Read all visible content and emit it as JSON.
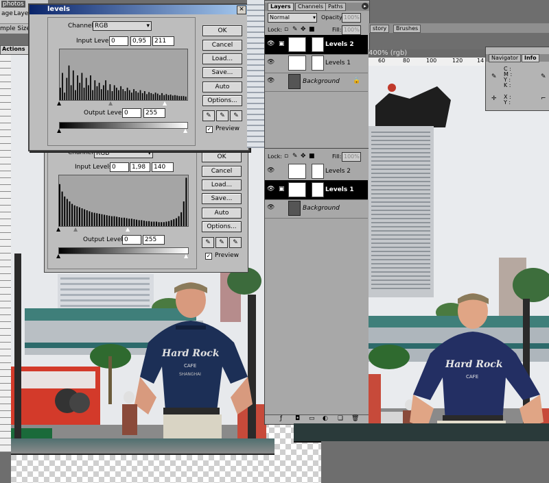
{
  "app": {
    "title_fragment": "photos",
    "menu": [
      "age",
      "Layer"
    ],
    "options_label": "mple Size:",
    "actions_tab": "Actions",
    "doc_title_fragment": "400% (rgb)",
    "ruler_marks": [
      "60",
      "80",
      "100",
      "120",
      "14"
    ]
  },
  "levels_top": {
    "title": "levels",
    "channel_label": "Channel:",
    "channel_value": "RGB",
    "input_label": "Input Levels:",
    "input_values": [
      "0",
      "0,95",
      "211"
    ],
    "output_label": "Output Levels:",
    "output_values": [
      "0",
      "255"
    ],
    "buttons": [
      "OK",
      "Cancel",
      "Load...",
      "Save...",
      "Auto",
      "Options..."
    ],
    "preview_label": "Preview",
    "histogram": [
      0.25,
      0.55,
      0.15,
      0.45,
      0.7,
      0.3,
      0.6,
      0.2,
      0.5,
      0.35,
      0.55,
      0.25,
      0.45,
      0.3,
      0.5,
      0.2,
      0.4,
      0.28,
      0.35,
      0.22,
      0.3,
      0.4,
      0.2,
      0.32,
      0.18,
      0.3,
      0.25,
      0.2,
      0.28,
      0.22,
      0.18,
      0.25,
      0.2,
      0.15,
      0.22,
      0.18,
      0.15,
      0.2,
      0.14,
      0.18,
      0.12,
      0.16,
      0.14,
      0.12,
      0.15,
      0.13,
      0.1,
      0.14,
      0.1,
      0.12,
      0.1,
      0.11,
      0.09,
      0.1,
      0.09,
      0.08,
      0.08,
      0.08,
      0.07
    ]
  },
  "levels_bottom": {
    "channel_label": "Channel:",
    "channel_value": "RGB",
    "input_label": "Input Levels:",
    "input_values": [
      "0",
      "1,98",
      "140"
    ],
    "output_label": "Output Levels:",
    "output_values": [
      "0",
      "255"
    ],
    "buttons": [
      "OK",
      "Cancel",
      "Load...",
      "Save...",
      "Auto",
      "Options..."
    ],
    "preview_label": "Preview",
    "histogram": [
      0.85,
      0.7,
      0.6,
      0.55,
      0.5,
      0.45,
      0.42,
      0.4,
      0.38,
      0.36,
      0.34,
      0.32,
      0.3,
      0.28,
      0.27,
      0.26,
      0.25,
      0.24,
      0.23,
      0.22,
      0.21,
      0.2,
      0.2,
      0.19,
      0.18,
      0.17,
      0.17,
      0.16,
      0.15,
      0.15,
      0.14,
      0.13,
      0.12,
      0.12,
      0.11,
      0.1,
      0.1,
      0.09,
      0.09,
      0.09,
      0.08,
      0.08,
      0.08,
      0.09,
      0.1,
      0.12,
      0.14,
      0.16,
      0.2,
      0.28,
      0.5,
      0.98
    ]
  },
  "layers_top": {
    "tabs": [
      "Layers",
      "Channels",
      "Paths"
    ],
    "blend_mode": "Normal",
    "opacity_label": "Opacity:",
    "opacity_value": "100%",
    "lock_label": "Lock:",
    "fill_label": "Fill:",
    "fill_value": "100%",
    "rows": [
      "Levels 2",
      "Levels 1",
      "Background"
    ]
  },
  "layers_bottom": {
    "lock_label": "Lock:",
    "fill_label": "Fill:",
    "fill_value": "100%",
    "rows": [
      "Levels 2",
      "Levels 1",
      "Background"
    ]
  },
  "side_tabs": [
    "story",
    "Brushes"
  ],
  "info_panel": {
    "tabs": [
      "Navigator",
      "Info"
    ],
    "cmyk_labels": [
      "C :",
      "M :",
      "Y :",
      "K :"
    ],
    "xy_labels": [
      "X :",
      "Y :"
    ]
  },
  "photo": {
    "shirt_text": "Hard Rock",
    "shirt_sub": "CAFE",
    "shirt_city": "SHANGHAI"
  },
  "colors": {
    "panel": "#bdbdbd",
    "titlebar": "#0a246a",
    "selected_row": "#000000"
  }
}
